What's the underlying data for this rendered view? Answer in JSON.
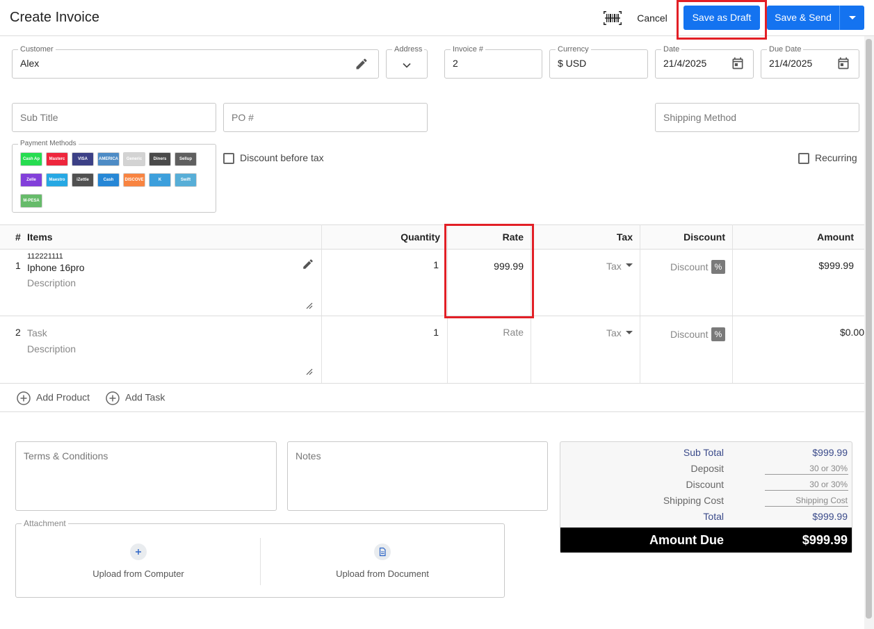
{
  "header": {
    "title": "Create Invoice",
    "barcode_icon": "barcode-scan-icon",
    "cancel_label": "Cancel",
    "save_draft_label": "Save as Draft",
    "save_send_label": "Save & Send",
    "accent_color": "#1473f0",
    "highlight_color": "#e21f26"
  },
  "form": {
    "customer": {
      "label": "Customer",
      "value": "Alex",
      "icon": "pencil-icon"
    },
    "address": {
      "label": "Address",
      "icon": "chevron-down-icon"
    },
    "invoice_number": {
      "label": "Invoice #",
      "value": "2"
    },
    "currency": {
      "label": "Currency",
      "value": "$ USD"
    },
    "date": {
      "label": "Date",
      "value": "21/4/2025",
      "icon": "calendar-icon"
    },
    "due_date": {
      "label": "Due Date",
      "value": "21/4/2025",
      "icon": "calendar-icon"
    },
    "sub_title": {
      "placeholder": "Sub Title"
    },
    "po_number": {
      "placeholder": "PO #"
    },
    "shipping_method": {
      "placeholder": "Shipping Method"
    },
    "payment_methods": {
      "label": "Payment Methods",
      "items": [
        {
          "name": "Cash App",
          "color": "#00d632"
        },
        {
          "name": "Mastercard",
          "color": "#eb001b"
        },
        {
          "name": "VISA",
          "color": "#1a1f71"
        },
        {
          "name": "AMERICAN EXPRESS",
          "color": "#2e77bb"
        },
        {
          "name": "Generic card",
          "color": "#cccccc"
        },
        {
          "name": "Diners",
          "color": "#2b2b2b"
        },
        {
          "name": "Sellup",
          "color": "#444444"
        },
        {
          "name": "Zelle",
          "color": "#6d1ed4"
        },
        {
          "name": "Maestro",
          "color": "#0099df"
        },
        {
          "name": "iZettle",
          "color": "#333333"
        },
        {
          "name": "Cash",
          "color": "#0073cf"
        },
        {
          "name": "DISCOVER",
          "color": "#f76f20"
        },
        {
          "name": "K",
          "color": "#1b8fd6"
        },
        {
          "name": "Swift",
          "color": "#3aa0d0"
        },
        {
          "name": "M-PESA",
          "color": "#4caf50"
        }
      ]
    },
    "discount_before_tax": {
      "label": "Discount before tax",
      "checked": false
    },
    "recurring": {
      "label": "Recurring",
      "checked": false
    }
  },
  "table": {
    "headers": {
      "num": "#",
      "items": "Items",
      "quantity": "Quantity",
      "rate": "Rate",
      "tax": "Tax",
      "discount": "Discount",
      "amount": "Amount"
    },
    "rows": [
      {
        "num": "1",
        "code": "112221111",
        "name": "Iphone 16pro",
        "description_placeholder": "Description",
        "quantity": "1",
        "rate": "999.99",
        "tax_placeholder": "Tax",
        "discount_placeholder": "Discount",
        "discount_type": "%",
        "amount": "$999.99"
      },
      {
        "num": "2",
        "name_placeholder": "Task",
        "description_placeholder": "Description",
        "quantity": "1",
        "rate_placeholder": "Rate",
        "tax_placeholder": "Tax",
        "discount_placeholder": "Discount",
        "discount_type": "%",
        "amount": "$0.00"
      }
    ],
    "add_product_label": "Add Product",
    "add_task_label": "Add Task"
  },
  "bottom": {
    "terms_placeholder": "Terms & Conditions",
    "notes_placeholder": "Notes",
    "attachment_label": "Attachment",
    "upload_computer_label": "Upload from Computer",
    "upload_document_label": "Upload from Document"
  },
  "totals": {
    "sub_total_label": "Sub Total",
    "sub_total_value": "$999.99",
    "deposit_label": "Deposit",
    "deposit_placeholder": "30 or 30%",
    "discount_label": "Discount",
    "discount_placeholder": "30 or 30%",
    "shipping_label": "Shipping Cost",
    "shipping_placeholder": "Shipping Cost",
    "total_label": "Total",
    "total_value": "$999.99",
    "amount_due_label": "Amount Due",
    "amount_due_value": "$999.99",
    "link_color": "#3a4a8a"
  }
}
